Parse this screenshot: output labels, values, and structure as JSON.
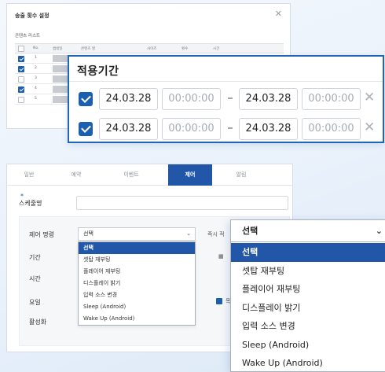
{
  "schedule_dialog": {
    "title": "송출 횟수 설정",
    "close_glyph": "✕",
    "subtitle": "콘텐츠 리스트",
    "columns": [
      "No.",
      "썸네일",
      "콘텐츠 명",
      "사이즈",
      "횟수",
      "시간"
    ],
    "rows": [
      {
        "no": "1",
        "checked": true
      },
      {
        "no": "2",
        "checked": true
      },
      {
        "no": "3",
        "checked": false
      },
      {
        "no": "4",
        "checked": true
      },
      {
        "no": "5",
        "checked": false
      }
    ]
  },
  "period_zoom": {
    "title": "적용기간",
    "dash": "–",
    "remove_glyph": "✕",
    "rows": [
      {
        "start_date": "24.03.28",
        "start_time": "00:00:00",
        "end_date": "24.03.28",
        "end_time": "00:00:00",
        "checked": true
      },
      {
        "start_date": "24.03.28",
        "start_time": "00:00:00",
        "end_date": "24.03.28",
        "end_time": "00:00:00",
        "checked": true
      }
    ]
  },
  "tabs_panel": {
    "tabs": [
      {
        "label": "일반",
        "active": false
      },
      {
        "label": "예약",
        "active": false
      },
      {
        "label": "이벤트",
        "active": false
      },
      {
        "label": "제어",
        "active": true
      },
      {
        "label": "알림",
        "active": false
      }
    ],
    "required_mark": "*",
    "schedule_name_label": "스케줄명",
    "form_labels": {
      "control_command": "제어 명령",
      "period": "기간",
      "time": "시간",
      "day": "요일",
      "activate": "활성화"
    },
    "select_value": "선택",
    "select_arrow": "⌄",
    "side_label_immediate": "즉시 적",
    "side_label_day": "목",
    "calendar_glyph": "▦",
    "options": [
      "선택",
      "셋탑 재부팅",
      "플레이어 재부팅",
      "디스플레이 밝기",
      "입력 소스 변경",
      "Sleep (Android)",
      "Wake Up (Android)"
    ]
  },
  "dropdown_zoom": {
    "select_value": "선택",
    "arrow": "⌄",
    "options": [
      "선택",
      "셋탑 재부팅",
      "플레이어 재부팅",
      "디스플레이 밝기",
      "입력 소스 변경",
      "Sleep (Android)",
      "Wake Up (Android)"
    ]
  },
  "colors": {
    "accent": "#2156a8",
    "check": "#1b5fb1",
    "border_highlight": "#1f66b8"
  }
}
